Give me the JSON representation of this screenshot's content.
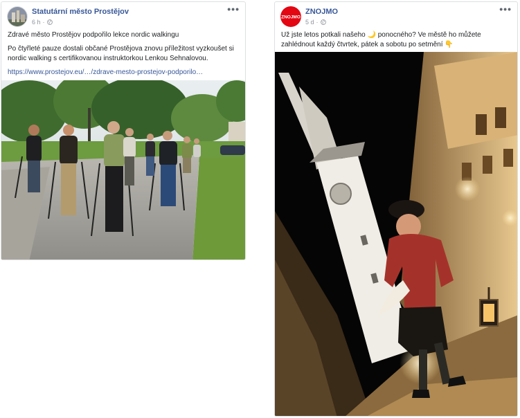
{
  "posts": [
    {
      "page_name": "Statutární město Prostějov",
      "time": "6 h",
      "more": "•••",
      "text_lines": [
        "Zdravé město Prostějov podpořilo lekce nordic walkingu",
        "Po čtyřleté pauze dostali občané Prostějova znovu příležitost vyzkoušet si nordic walking s certifikovanou instruktorkou Lenkou Sehnalovou."
      ],
      "link": "https://www.prostejov.eu/…/zdrave-mesto-prostejov-podporilo…",
      "avatar_icon": "city-crest-icon",
      "photo_icon": "nordic-walking-photo"
    },
    {
      "page_name": "ZNOJMO",
      "avatar_text": "ZNOJMO",
      "time": "5 d",
      "more": "•••",
      "text": "Už jste letos potkali našeho 🌙 ponocného? Ve městě ho můžete zahlédnout každý čtvrtek, pátek a sobotu po setmění 👇",
      "avatar_color": "#e30613",
      "photo_icon": "night-watchman-photo"
    }
  ],
  "colors": {
    "link": "#385898",
    "meta": "#90949c",
    "border": "#dddfe2"
  }
}
